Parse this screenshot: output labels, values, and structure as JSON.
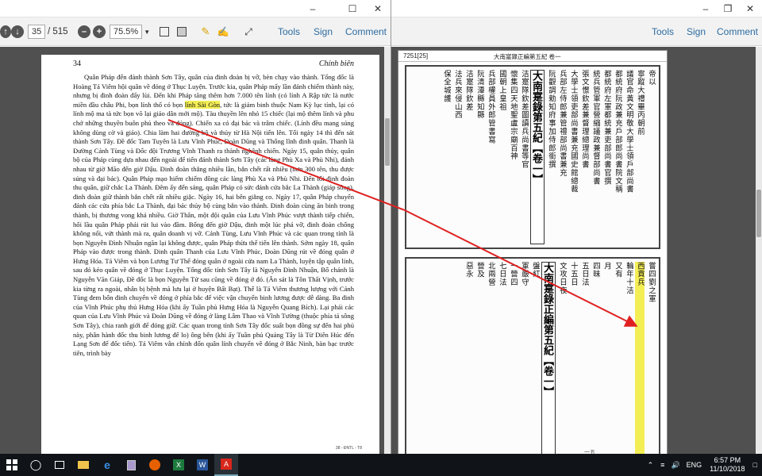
{
  "left_window": {
    "toolbar": {
      "page_current": "35",
      "page_total": "/ 515",
      "zoom": "75.5%",
      "tools": "Tools",
      "sign": "Sign",
      "comment": "Comment"
    },
    "page": {
      "number": "34",
      "running_head": "Chính biên",
      "paragraphs": [
        "Quân Pháp đến đánh thành Sơn Tây, quân của đinh đoàn bị vỡ, bèn chạy vào thành. Tổng đốc là Hoàng Tá Viêm hội quân về đóng ở Thục Luyện. Trước kia, quân Pháp mấy lần đánh chiếm thành này, nhưng bị đinh đoàn đẩy lùi. Đến khi Pháp tăng thêm hơn 7.000 tên lính (có lính A Rập tức là nước miền đầu châu Phi, bọn lính thổ có bọn",
        "lính Sài Gòn",
        ", tức là giám binh thuộc Nam Kỳ lục tỉnh, lại có lính mộ ma tà tức bọn võ lại giáo dân mới mộ). Tàu thuyền lên nhỏ 15 chiếc (lại mộ thêm lính và phu chở những thuyền buôn phủ theo và đóng). Chiến xa có đại bác và trâm chiếc. (Lính đều mang súng không dùng cờ và giáo). Chia làm hai đường bộ và thủy từ Hà Nội tiến lên. Tối ngày 14 thì đến sát thành Sơn Tây. Đề đốc Tam Tuyên là Lưu Vĩnh Phúc, Đoàn Dũng và Thống lĩnh đinh quân. Thanh là Đường Cảnh Tùng và Đốc đội Trương Vĩnh Thanh ra thành nghênh chiến. Ngày 15, quân thủy, quân bộ của Pháp cùng dựa nhau đến ngoài để tiến đánh thành Sơn Tây (các làng Phù Xa và Phù Nhi), đánh nhau từ giờ Mão đến giờ Dậu. Đinh đoàn thắng nhiều lần, bắn chết rất nhiều (hơn 300 tên, thu được súng và đại bác). Quân Pháp mạo hiểm chiếm đồng các làng Phù Xa và Phù Nhi. Đến tối đinh đoàn thu quân, giữ chắc La Thành. Đêm ấy đến sáng, quân Pháp có sức đánh cửa bắc La Thành (giáp sông), đinh đoàn giữ thành bắn chết rất nhiều giặc. Ngày 16, hai bên giằng co. Ngày 17, quân Pháp chuyển đánh các cửa phía bắc La Thành, đại bác thủy bộ cùng bắn vào thành. Đinh đoàn cùng ăn binh trong thành, bị thương vong khá nhiều. Giờ Thân, một đội quân của Lưu Vĩnh Phúc vượt thành tiếp chiến, hối lầu quân Pháp phải rút lui vào đầm. Bống đến giờ Dậu, đinh một lúc phá vỡ, đinh đoàn chống không nổi, vứt thành mà ra, quân doanh vị vỡ. Cảnh Tùng, Lưu Vĩnh Phúc và các quan trong tỉnh là bọn Nguyễn Đình Nhuận ngăn lại không được, quân Pháp thừa thế tiến lên thành. Sớm ngày 18, quân Pháp vào được trong thành. Đinh quân Thanh của Lưu Vĩnh Phúc, Đoàn Dũng rút về đóng quân ở Hưng Hóa. Tá Viêm và bọn Lương Tư Thế đóng quân ở ngoài cửa nam La Thành, luyện tập quân lính, sau đó kéo quân về đóng ở Thục Luyện. Tổng đốc tỉnh Sơn Tây là Nguyễn Đình Nhuận, Bố chánh là Nguyễn Văn Giáp, Đề đốc là bọn Nguyễn Tử sau cũng về đóng ở đó. (Ăn sát là Tôn Thất Vịnh, trước kia từng ra ngoài, nhân bị bệnh mà lưu lại ở huyện Bất Bạt). Thế là Tá Viêm thương lượng với Cảnh Tùng đem bốn đinh chuyển về đóng ở phía bắc để việc vận chuyển binh lương được dễ dàng. Ba đinh của Vĩnh Phúc phụ thủ Hưng Hóa (khi ấy Tuần phủ Hưng Hóa là Nguyễn Quang Bích). Lại phái các quan của Lưu Vĩnh Phúc và Đoàn Dũng về đóng ở làng Lâm Thao và Vĩnh Tường (thuộc phía tả sông Sơn Tây), chia ranh giới để đóng giữ. Các quan trong tỉnh Sơn Tây đốc suất bọn đồng sự đến hai phủ này, phân hành đốc thu binh lương để lo) ông bên (khi ấy Tuần phủ Quảng Tây là Từ Diên Húc đến Lạng Sơn để đốc tiến). Tá Viêm vẫn chỉnh đốn quân lính chuyển về đóng ở Bắc Ninh, bàn bạc trước tiên, trình bày"
      ],
      "footer": "38 - ĐNTL - T8"
    }
  },
  "right_window": {
    "toolbar": {
      "tools": "Tools",
      "sign": "Sign",
      "comment": "Comment"
    },
    "page": {
      "header_left": "7251[25]",
      "header_mid": "大南寔錄正編第五紀  卷一",
      "top_title": "大南寔錄第五紀【卷一】",
      "top_cols": [
        "帝以",
        "寧蹤大禮畢丙朝前",
        "議官命黃文明敬大學士領戶部尚書",
        "都統府阮政兼充戶部郎尚書院文稱",
        "都統府左軍都統兼吏部尚書官撰",
        "統兵管軍官營縮議政兼督部尚書",
        "張文憬欽差兼督理總理尚書",
        "大學士領吏部尚書兼充國史館總裁",
        "兵部左侍郎兼管禮部尚書兼充",
        "阮觀調勑知府事加侍郎銜撰",
        "洁寔隊欽差圖讀兵尚書等官",
        "懷集四天地聖盧宗廟百神",
        "國朝上皇祖",
        "兵部權員外郎管書寫",
        "阮清潭縣知縣",
        "洁寔隊欽差",
        "法兵來侵山西",
        "保全城護"
      ],
      "bottom_title": "大南寔錄正編第五紀【卷一】",
      "bottom_cols": [
        "嘗四劉之軍",
        "輪年十洁",
        "又有",
        "月",
        "四昧",
        "五日法",
        "十五日",
        "文攻日夜",
        "盤紅",
        "軍嚴守",
        "一營四",
        "七日法",
        "北兩營",
        "營及",
        "惡永"
      ],
      "highlighted_chars": "西貢兵",
      "page_sig": "一五"
    }
  },
  "taskbar": {
    "lang": "ENG",
    "time": "6:57 PM",
    "date": "11/10/2018"
  },
  "colors": {
    "highlight": "#f4ee55",
    "arrow": "#e02020",
    "toolbar_link": "#2d6ca2"
  }
}
